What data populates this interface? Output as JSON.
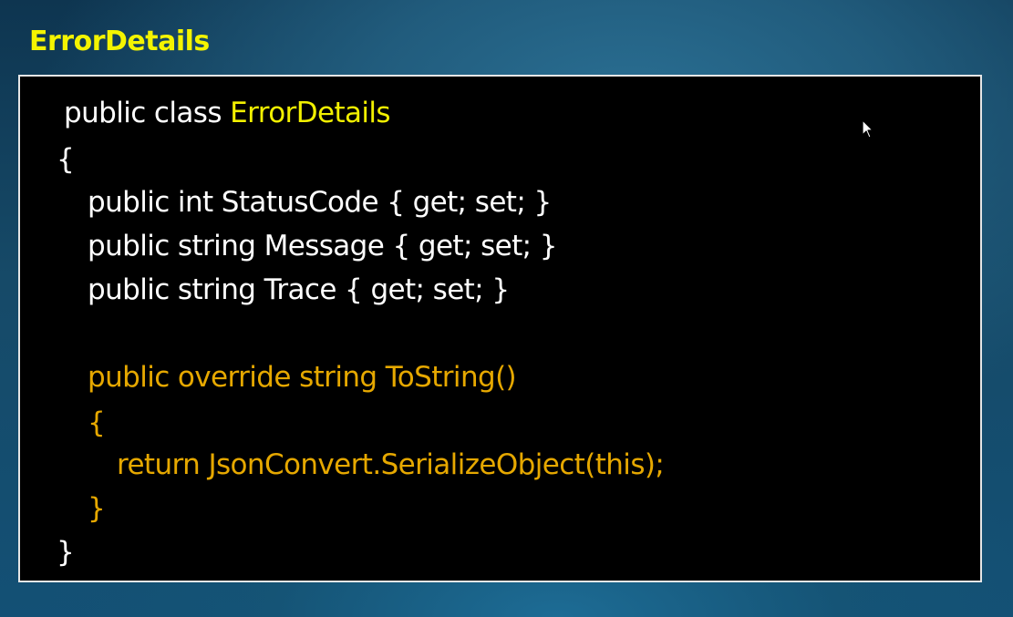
{
  "slide": {
    "title": "ErrorDetails"
  },
  "code": {
    "line1": {
      "keyword": "public class ",
      "class_name": "ErrorDetails"
    },
    "line2": "{",
    "line3": "public int StatusCode { get; set; }",
    "line4": "public string Message { get; set; }",
    "line5": "public string Trace { get; set; }",
    "line6": "public override string ToString()",
    "line7": "{",
    "line8": "return JsonConvert.SerializeObject(this);",
    "line9": "}",
    "line10": "}"
  },
  "colors": {
    "title": "#f4f400",
    "code_default": "#ffffff",
    "class_name": "#f2f000",
    "method": "#e6a800",
    "code_background": "#000000"
  },
  "icons": {
    "cursor": "mouse-pointer-icon"
  }
}
